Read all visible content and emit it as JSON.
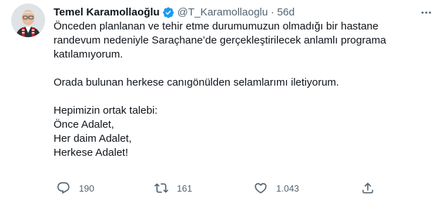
{
  "tweet": {
    "author_name": "Temel Karamollaoğlu",
    "handle": "@T_Karamollaoglu",
    "separator": "·",
    "time": "56d",
    "verified": true,
    "lines": [
      "Önceden planlanan ve tehir etme durumumuzun olmadığı bir hastane",
      "randevum nedeniyle Saraçhane’de gerçekleştirilecek anlamlı programa",
      "katılamıyorum.",
      "Orada bulunan herkese canıgönülden selamlarımı iletiyorum.",
      "Hepimizin ortak talebi:",
      "Önce Adalet,",
      "Her daim Adalet,",
      "Herkese Adalet!"
    ],
    "actions": {
      "reply_count": "190",
      "retweet_count": "161",
      "like_count": "1.043"
    }
  },
  "colors": {
    "text": "#0f1419",
    "secondary": "#536471",
    "verified": "#1d9bf0"
  },
  "icons": [
    "avatar",
    "verified-badge-icon",
    "more-icon",
    "reply-icon",
    "retweet-icon",
    "like-icon",
    "share-icon"
  ]
}
